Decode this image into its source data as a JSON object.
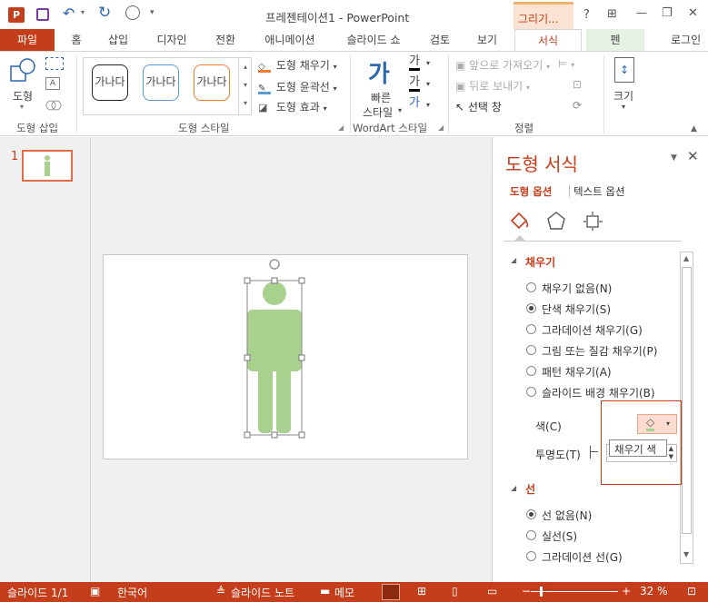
{
  "window": {
    "title": "프레젠테이션1 - PowerPoint",
    "context_tab": "그리기...",
    "help": "?",
    "minimize": "—",
    "close": "✕",
    "restore": "❐",
    "ribbon_display": "⊞"
  },
  "tabs": [
    "파일",
    "홈",
    "삽입",
    "디자인",
    "전환",
    "애니메이션",
    "슬라이드 쇼",
    "검토",
    "보기",
    "서식",
    "펜"
  ],
  "signin": "로그인",
  "ribbon": {
    "insert_shapes": {
      "label": "도형 삽입",
      "shapes_button": "도형"
    },
    "styles": {
      "label": "도형 스타일",
      "swatches": [
        "가나다",
        "가나다",
        "가나다"
      ],
      "fill": "도형 채우기",
      "outline": "도형 윤곽선",
      "effect": "도형 효과"
    },
    "wordart": {
      "label": "WordArt 스타일",
      "quick_line1": "빠른",
      "quick_line2": "스타일"
    },
    "arrange": {
      "label": "정렬",
      "bring_forward": "앞으로 가져오기",
      "send_backward": "뒤로 보내기",
      "selection_pane": "선택 창"
    },
    "size": {
      "label": "크기"
    }
  },
  "thumbnail": {
    "number": "1"
  },
  "pane": {
    "title": "도형 서식",
    "tab_shape": "도형 옵션",
    "tab_text": "텍스트 옵션",
    "fill_section": "채우기",
    "fill_options": [
      {
        "label": "채우기 없음(N)",
        "selected": false
      },
      {
        "label": "단색 채우기(S)",
        "selected": true
      },
      {
        "label": "그라데이션 채우기(G)",
        "selected": false
      },
      {
        "label": "그림 또는 질감 채우기(P)",
        "selected": false
      },
      {
        "label": "패턴 채우기(A)",
        "selected": false
      },
      {
        "label": "슬라이드 배경 채우기(B)",
        "selected": false
      }
    ],
    "color_label": "색(C)",
    "transparency_label": "투명도(T)",
    "tooltip": "채우기 색",
    "line_section": "선",
    "line_options": [
      {
        "label": "선 없음(N)",
        "selected": true
      },
      {
        "label": "실선(S)",
        "selected": false
      },
      {
        "label": "그라데이션 선(G)",
        "selected": false
      }
    ]
  },
  "status": {
    "slide": "슬라이드 1/1",
    "language": "한국어",
    "notes": "슬라이드 노트",
    "comments": "메모",
    "zoom": "32 %"
  },
  "colors": {
    "accent": "#c43e1c",
    "shape_fill": "#a9d18e"
  }
}
